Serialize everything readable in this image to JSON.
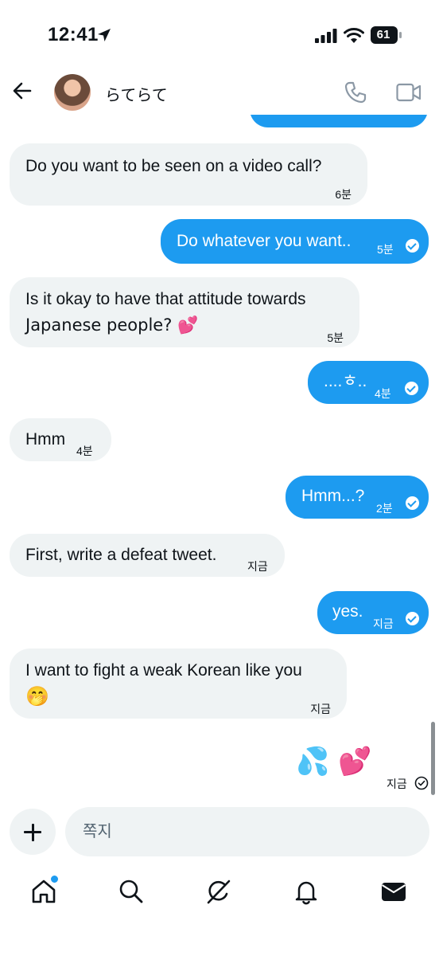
{
  "status": {
    "time": "12:41",
    "battery": "61"
  },
  "header": {
    "contact_name": "らてらて"
  },
  "messages": [
    {
      "dir": "in",
      "text": "Do you want to be seen on a video call?",
      "time": "6분"
    },
    {
      "dir": "out",
      "text": "Do whatever you want..",
      "time": "5분"
    },
    {
      "dir": "in",
      "line1": "Is it okay to have that attitude towards",
      "line2": "Japanese people? 💕",
      "time": "5분"
    },
    {
      "dir": "out",
      "text": "....ㅎ..",
      "time": "4분"
    },
    {
      "dir": "in",
      "text": "Hmm",
      "time": "4분"
    },
    {
      "dir": "out",
      "text": "Hmm...?",
      "time": "2분"
    },
    {
      "dir": "in",
      "text": "First, write a defeat tweet.",
      "time": "지금"
    },
    {
      "dir": "out",
      "text": "yes.",
      "time": "지금"
    },
    {
      "dir": "in",
      "line1": "I want to fight a weak Korean like you",
      "line2": "🤭",
      "time": "지금"
    },
    {
      "dir": "out",
      "text": "💦 💕",
      "time": "지금"
    }
  ],
  "composer": {
    "placeholder": "쪽지"
  },
  "icons": [
    "back-arrow-icon",
    "phone-icon",
    "video-icon",
    "plus-icon",
    "home-icon",
    "search-icon",
    "grok-icon",
    "notifications-icon",
    "messages-icon"
  ],
  "colors": {
    "accent": "#1d9bf0",
    "incoming_bubble": "#eff3f4"
  }
}
